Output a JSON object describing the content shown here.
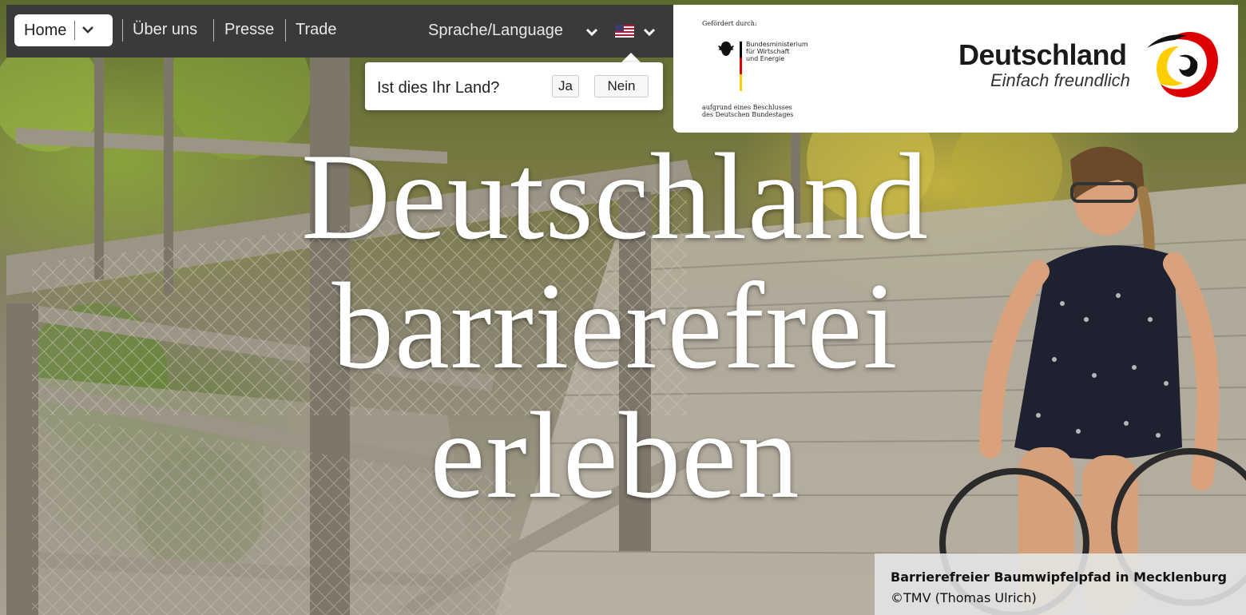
{
  "nav": {
    "home_label": "Home",
    "links": [
      "Über uns",
      "Presse",
      "Trade"
    ],
    "language_label": "Sprache/Language",
    "flag_icon": "us-flag-icon"
  },
  "country_prompt": {
    "question": "Ist dies Ihr Land?",
    "yes_label": "Ja",
    "no_label": "Nein"
  },
  "sponsor": {
    "gefoerdert": "Gefördert durch:",
    "ministry_line1": "Bundesministerium",
    "ministry_line2": "für Wirtschaft",
    "ministry_line3": "und Energie",
    "resolution_line1": "aufgrund eines Beschlusses",
    "resolution_line2": "des Deutschen Bundestages",
    "brand_title": "Deutschland",
    "brand_subtitle": "Einfach freundlich"
  },
  "hero": {
    "headline_line1": "Deutschland",
    "headline_line2": "barrierefrei",
    "headline_line3": "erleben"
  },
  "caption": {
    "title": "Barrierefreier Baumwipfelpfad in Mecklenburg",
    "credit": "©TMV (Thomas Ulrich)"
  },
  "colors": {
    "nav_bg": "#3a3a3a",
    "flag_red": "#c8102e",
    "flag_blue": "#3c3b6e",
    "de_black": "#000000",
    "de_red": "#dd0000",
    "de_gold": "#ffce00"
  }
}
